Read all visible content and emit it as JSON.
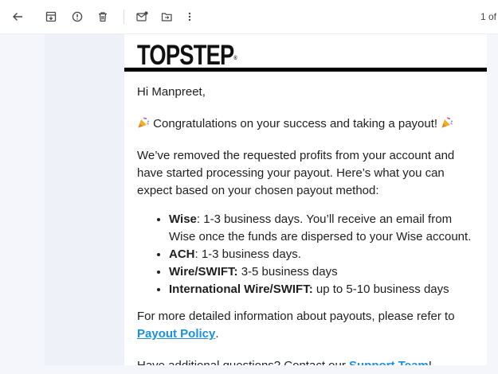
{
  "toolbar": {
    "page_count": "1 of"
  },
  "email": {
    "brand": "TOPSTEP",
    "brand_mark": "®",
    "greeting": "Hi Manpreet,",
    "congrats": "Congratulations on your success and taking a payout!",
    "intro": "We’ve removed the requested profits from your account and have started processing your payout. Here’s what you can expect based on your chosen payout method:",
    "methods": [
      {
        "name": "Wise",
        "sep": ":",
        "detail": " 1-3 business days. You’ll receive an email from Wise once the funds are dispersed to your Wise account."
      },
      {
        "name": "ACH",
        "sep": ":",
        "detail": " 1-3 business days."
      },
      {
        "name": "Wire/SWIFT:",
        "sep": "",
        "detail": " 3-5 business days"
      },
      {
        "name": "International Wire/SWIFT:",
        "sep": "",
        "detail": " up to 5-10 business days"
      }
    ],
    "more_info_prefix": "For more detailed information about payouts, please refer to ",
    "more_info_link": "Payout Policy",
    "more_info_suffix": ".",
    "questions_prefix": "Have additional questions? Contact our ",
    "questions_link": "Support Team",
    "questions_suffix": "!"
  },
  "icons": {
    "back": "arrow-left-icon",
    "archive": "archive-icon",
    "report": "report-spam-icon",
    "delete": "trash-icon",
    "unread": "mark-unread-icon",
    "move": "move-to-folder-icon",
    "more": "more-vert-icon",
    "party": "party-popper-icon"
  }
}
